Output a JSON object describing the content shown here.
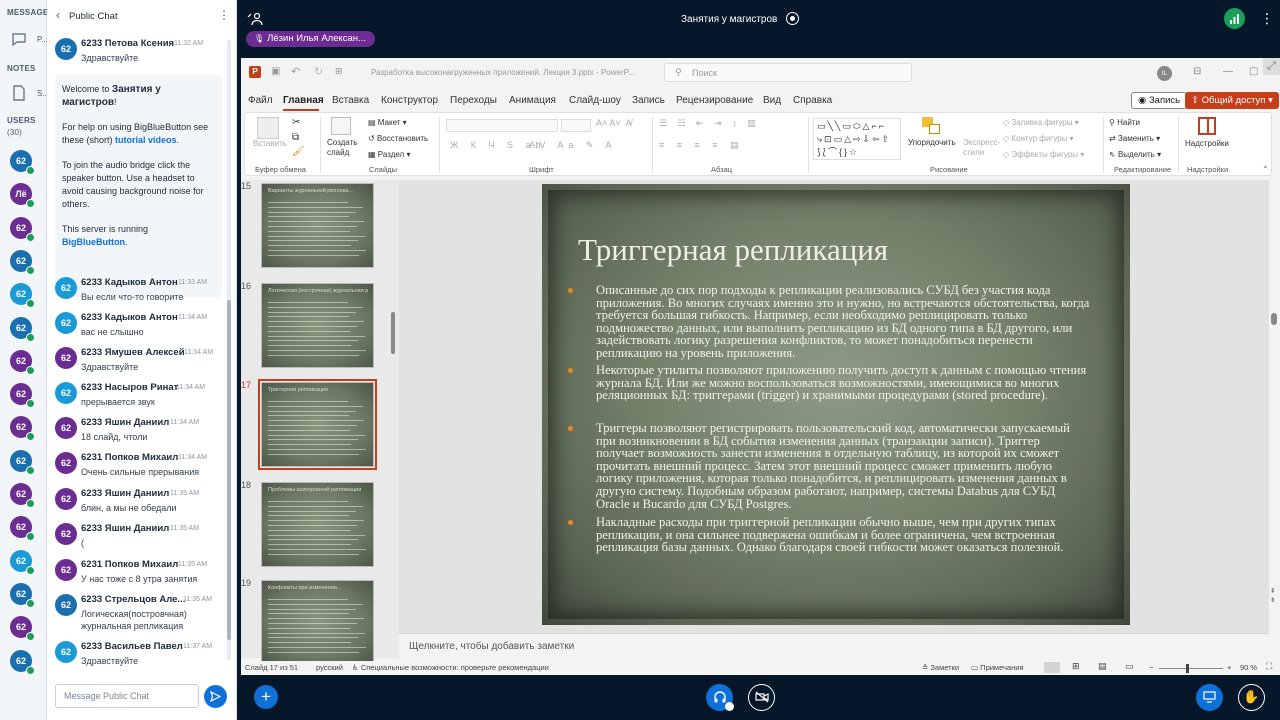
{
  "rail": {
    "messages_label": "MESSAGES",
    "public_chat_short": "P...",
    "notes_label": "NOTES",
    "notes_short": "S...",
    "users_label": "USERS",
    "users_count": "(30)",
    "users": [
      {
        "initials": "62",
        "color": "#1a6fb0",
        "badge": "e"
      },
      {
        "initials": "Лё",
        "color": "#6b2d91",
        "badge": "e"
      },
      {
        "initials": "62",
        "color": "#6b2d91",
        "badge": "e"
      },
      {
        "initials": "62",
        "color": "#1a6fb0",
        "badge": "e"
      },
      {
        "initials": "62",
        "color": "#1a9ad6",
        "badge": "e"
      },
      {
        "initials": "62",
        "color": "#1a6fb0",
        "badge": "e"
      },
      {
        "initials": "62",
        "color": "#6b2d91",
        "badge": "e"
      },
      {
        "initials": "62",
        "color": "#6b2d91",
        "badge": "e"
      },
      {
        "initials": "62",
        "color": "#6b2d91",
        "badge": "e"
      },
      {
        "initials": "62",
        "color": "#1a6fb0",
        "badge": "e"
      },
      {
        "initials": "62",
        "color": "#6b2d91",
        "badge": "e"
      },
      {
        "initials": "62",
        "color": "#6b2d91",
        "badge": "e"
      },
      {
        "initials": "62",
        "color": "#1a9ad6",
        "badge": "e"
      },
      {
        "initials": "62",
        "color": "#1a6fb0",
        "badge": "e"
      },
      {
        "initials": "62",
        "color": "#6b2d91",
        "badge": "e"
      },
      {
        "initials": "62",
        "color": "#1a6fb0",
        "badge": "e"
      }
    ]
  },
  "chat": {
    "title": "Public Chat",
    "first": {
      "initials": "62",
      "color": "#1a6fb0",
      "name": "6233 Петова Ксения",
      "time": "11:32 AM",
      "text": "Здравствуйте"
    },
    "welcome": {
      "line1_pre": "Welcome to ",
      "line1_bold": "Занятия у магистров",
      "line1_post": "!",
      "help_pre": "For help on using BigBlueButton see these (short) ",
      "help_link": "tutorial videos",
      "help_post": ".",
      "audio": "To join the audio bridge click the speaker button. Use a headset to avoid causing background noise for others.",
      "server_pre": "This server is running ",
      "server_link": "BigBlueButton",
      "server_post": "."
    },
    "messages": [
      {
        "initials": "62",
        "color": "#1a9ad6",
        "name": "6233 Кадыков Антон",
        "time": "11:33 AM",
        "text": "Вы если что-то говорите"
      },
      {
        "initials": "62",
        "color": "#1a9ad6",
        "name": "6233 Кадыков Антон",
        "time": "11:34 AM",
        "text": "вас не слышно"
      },
      {
        "initials": "62",
        "color": "#6b2d91",
        "name": "6233 Ямушев Алексей",
        "time": "11:34 AM",
        "text": "Здравствуйте"
      },
      {
        "initials": "62",
        "color": "#1a9ad6",
        "name": "6233 Насыров Ринат",
        "time": "11:34 AM",
        "text": "прерывается звук"
      },
      {
        "initials": "62",
        "color": "#6b2d91",
        "name": "6233 Яшин Даниил",
        "time": "11:34 AM",
        "text": "18 слайд, чтоли"
      },
      {
        "initials": "62",
        "color": "#6b2d91",
        "name": "6231 Попков Михаил",
        "time": "11:34 AM",
        "text": "Очень сильные прерывания"
      },
      {
        "initials": "62",
        "color": "#6b2d91",
        "name": "6233 Яшин Даниил",
        "time": "11:35 AM",
        "text": "блин, а мы не обедали"
      },
      {
        "initials": "62",
        "color": "#6b2d91",
        "name": "6233 Яшин Даниил",
        "time": "11:35 AM",
        "text": "("
      },
      {
        "initials": "62",
        "color": "#6b2d91",
        "name": "6231 Попков Михаил",
        "time": "11:35 AM",
        "text": "У нас тоже с 8 утра занятия"
      },
      {
        "initials": "62",
        "color": "#1a6fb0",
        "name": "6233 Стрельцов Але...",
        "time": "11:35 AM",
        "text": "Логическая(постровчная) журнальная репликация"
      },
      {
        "initials": "62",
        "color": "#1a9ad6",
        "name": "6233 Васильев Павел",
        "time": "11:37 AM",
        "text": "Здравствуйте"
      }
    ],
    "input_placeholder": "Message Public Chat"
  },
  "topbar": {
    "meeting_title": "Занятия у магистров",
    "presenter_name": "Лёзин Илья Алексан..."
  },
  "ppt": {
    "filename": "Разработка высоконагруженных приложений. Лекция 3.pptx  -  PowerP...",
    "search_placeholder": "Поиск",
    "user_initials": "IL",
    "tabs": [
      "Файл",
      "Главная",
      "Вставка",
      "Конструктор",
      "Переходы",
      "Анимация",
      "Слайд-шоу",
      "Запись",
      "Рецензирование",
      "Вид",
      "Справка"
    ],
    "record_btn": "Запись",
    "share_btn": "Общий доступ",
    "ribbon": {
      "paste": "Вставить",
      "clipboard": "Буфер обмена",
      "new_slide": "Создать слайд",
      "layout": "Макет",
      "reset": "Восстановить",
      "section": "Раздел",
      "slides": "Слайды",
      "font": "Шрифт",
      "paragraph": "Абзац",
      "arrange": "Упорядочить",
      "express_styles": "Экспресс-стили",
      "fill": "Заливка фигуры",
      "outline": "Контур фигуры",
      "effects": "Эффекты фигуры",
      "drawing": "Рисование",
      "find": "Найти",
      "replace": "Заменить",
      "select": "Выделить",
      "editing": "Редактирование",
      "addins": "Надстройки",
      "addins_group": "Надстройки"
    },
    "thumbs": [
      {
        "num": "15",
        "title": "Варианты журнальной реплика..."
      },
      {
        "num": "16",
        "title": "Логическая (построчная) журнальная репликация"
      },
      {
        "num": "17",
        "title": "Триггерная репликация"
      },
      {
        "num": "18",
        "title": "Проблемы асинхронной репликации"
      },
      {
        "num": "19",
        "title": "Конфликты при изменении..."
      }
    ],
    "slide": {
      "title": "Триггерная репликация",
      "bullets": [
        "Описанные до сих пор подходы к репликации реализовались СУБД без участия кода приложения. Во многих случаях именно это и нужно, но встречаются обстоятельства, когда требуется большая гибкость. Например, если необходимо реплицировать только подмножество данных, или выполнить репликацию из БД одного типа в БД другого, или задействовать логику разрешения конфликтов, то может понадобиться перенести репликацию на уровень приложения.",
        "Некоторые утилиты позволяют приложению получить доступ к данным с помощью чтения журнала БД. Или же можно воспользоваться возможностями, имеющимися во многих реляционных БД: триггерами (trigger) и хранимыми процедурами (stored procedure).",
        "Триггеры позволяют регистрировать пользовательский код, автоматически запускаемый при возникновении в БД события изменения данных (транзакции записи). Триггер получает возможность занести изменения в отдельную таблицу, из которой их сможет прочитать внешний процесс. Затем этот внешний процесс сможет применить любую логику приложения, которая только понадобится, и реплицировать изменения данных в другую систему. Подобным образом работают, например, системы Databus для СУБД Oracle и Bucardo для СУБД Postgres.",
        "Накладные расходы при триггерной репликации обычно выше, чем при других типах репликации, и она сильнее подвержена ошибкам и более ограничена, чем встроенная репликация базы данных. Однако благодаря своей гибкости может оказаться полезной."
      ]
    },
    "notes_placeholder": "Щелкните, чтобы добавить заметки",
    "status": {
      "slide_of": "Слайд 17 из 51",
      "language": "русский",
      "accessibility": "Специальные возможности: проверьте рекомендации",
      "notes": "Заметки",
      "comments": "Примечания",
      "zoom": "90 %"
    }
  },
  "colors": {
    "bbb_blue": "#0f70d7",
    "dark_bg": "#06172a",
    "presenter_purple": "#6b2d91",
    "share_orange": "#c43e1c",
    "bullet_orange": "#e58a1f"
  }
}
